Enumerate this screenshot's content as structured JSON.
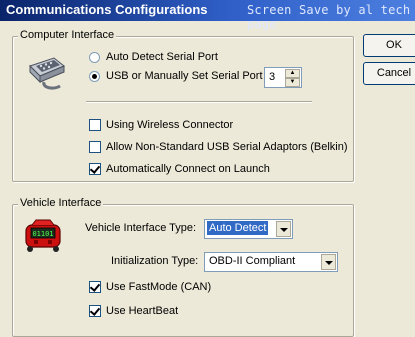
{
  "window": {
    "title": "Communications Configurations",
    "watermark": "Screen Save by al tech page"
  },
  "buttons": {
    "ok_label": "OK",
    "cancel_label": "Cancel"
  },
  "computer_interface": {
    "legend": "Computer Interface",
    "icon": "serial-port-connector-icon",
    "radio_auto_detect": {
      "label": "Auto Detect Serial Port",
      "selected": false
    },
    "radio_usb": {
      "label": "USB or Manually Set Serial Port",
      "selected": true
    },
    "port_number": "3",
    "checkboxes": [
      {
        "label": "Using Wireless Connector",
        "checked": false
      },
      {
        "label": "Allow Non-Standard USB Serial Adaptors (Belkin)",
        "checked": false
      },
      {
        "label": "Automatically Connect on Launch",
        "checked": true
      }
    ]
  },
  "vehicle_interface": {
    "legend": "Vehicle Interface",
    "icon": "vehicle-interface-obd-icon",
    "icon_text": "01101",
    "type_label": "Vehicle Interface Type:",
    "type_value": "Auto Detect",
    "init_label": "Initialization Type:",
    "init_value": "OBD-II Compliant",
    "checkboxes": [
      {
        "label": "Use FastMode (CAN)",
        "checked": true
      },
      {
        "label": "Use HeartBeat",
        "checked": true
      }
    ]
  }
}
